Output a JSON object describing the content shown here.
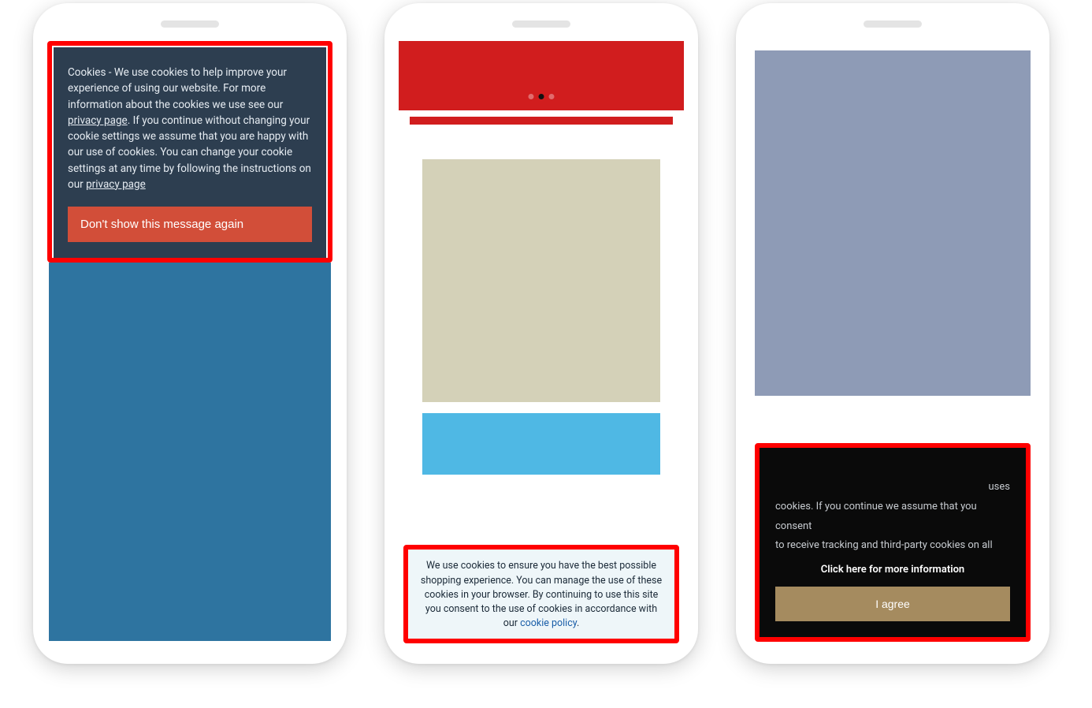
{
  "phones": {
    "phone1": {
      "cookie_text_1": "Cookies - We use cookies to help improve your experience of using our website. For more information about the cookies we use see our ",
      "link1": "privacy page",
      "cookie_text_2": ". If you continue without changing your cookie settings we assume that you are happy with our use of cookies. You can change your cookie settings at any time by following the instructions on our ",
      "link2": "privacy page",
      "dismiss_button": "Don't show this message again"
    },
    "phone2": {
      "cookie_text_1": "We use cookies to ensure you have the best possible shopping experience. You can manage the use of these cookies in your browser. By continuing to use this site you consent to the use of cookies in accordance with our ",
      "policy_link": "cookie policy",
      "period": "."
    },
    "phone3": {
      "cookie_text_line1_suffix": " uses",
      "cookie_text_line2": "cookies. If you continue we assume that you consent",
      "cookie_text_line3": "to receive tracking and third-party cookies on all",
      "more_info": "Click here for more information",
      "agree_button": "I agree"
    }
  }
}
